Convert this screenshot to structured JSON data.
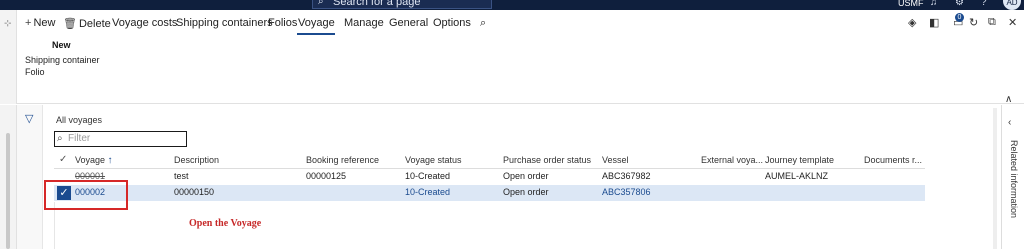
{
  "topbar": {
    "search_placeholder": "Search for a page",
    "company": "USMF",
    "avatar": "AD"
  },
  "actions": {
    "new": "New",
    "delete": "Delete",
    "voyage_costs": "Voyage costs",
    "shipping_containers": "Shipping containers",
    "folios": "Folios",
    "voyage": "Voyage",
    "manage": "Manage",
    "general": "General",
    "options": "Options",
    "badge": "0"
  },
  "ribbon": {
    "group_title": "New",
    "items": [
      "Shipping container",
      "Folio"
    ]
  },
  "list": {
    "title": "All voyages",
    "filter_placeholder": "Filter"
  },
  "grid": {
    "columns": [
      "Voyage",
      "Description",
      "Booking reference",
      "Voyage status",
      "Purchase order status",
      "Vessel",
      "External voya...",
      "Journey template",
      "Documents r..."
    ],
    "sort_indicator": "↑",
    "rows": [
      [
        "000001",
        "test",
        "00000125",
        "10-Created",
        "Open order",
        "ABC367982",
        "",
        "AUMEL-AKLNZ",
        ""
      ],
      [
        "000002",
        "00000150",
        "",
        "10-Created",
        "Open order",
        "ABC357806",
        "",
        "",
        ""
      ]
    ]
  },
  "annotation": "Open the Voyage",
  "right_panel": {
    "label": "Related information"
  },
  "colors": {
    "nav": "#0f1f3d",
    "accent": "#1b4b8f",
    "selected_row": "#dce7f5",
    "annotation": "#d62828"
  }
}
